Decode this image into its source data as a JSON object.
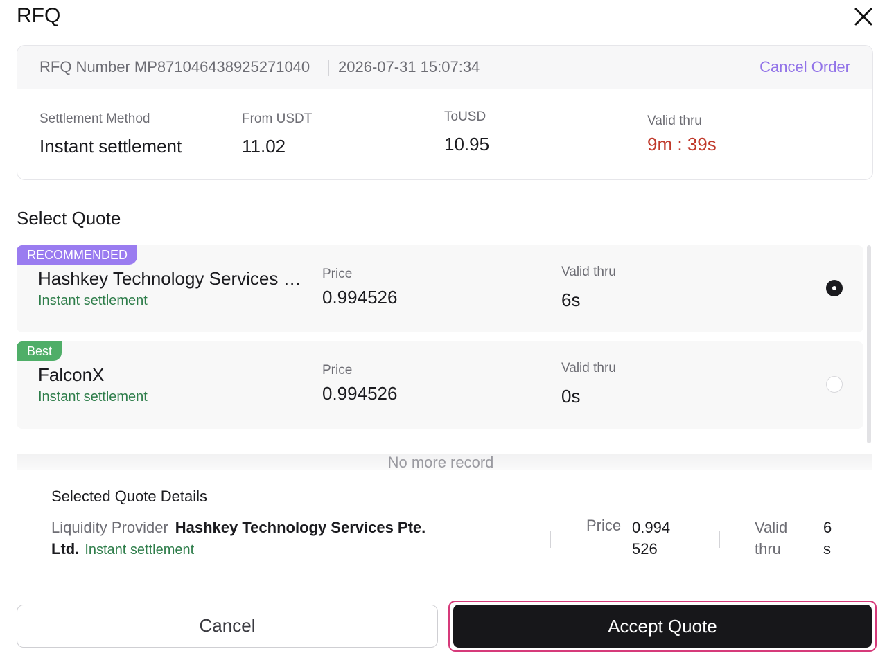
{
  "dialog": {
    "title": "RFQ"
  },
  "summary": {
    "rfq_number": "RFQ Number MP871046438925271040",
    "timestamp": "2026-07-31 15:07:34",
    "cancel_order_label": "Cancel Order",
    "fields": {
      "settlement_label": "Settlement Method",
      "settlement_value": "Instant settlement",
      "from_label": "From USDT",
      "from_value": "11.02",
      "to_label": "ToUSD",
      "to_value": "10.95",
      "valid_label": "Valid thru",
      "valid_value": "9m : 39s"
    }
  },
  "quotes": {
    "title": "Select Quote",
    "items": [
      {
        "badge": "RECOMMENDED",
        "name": "Hashkey Technology Services Pte. Ltd.",
        "settlement": "Instant settlement",
        "price_label": "Price",
        "price": "0.994526",
        "valid_label": "Valid thru",
        "valid": "6s",
        "selected": true
      },
      {
        "badge": "Best",
        "name": "FalconX",
        "settlement": "Instant settlement",
        "price_label": "Price",
        "price": "0.994526",
        "valid_label": "Valid thru",
        "valid": "0s",
        "selected": false
      }
    ],
    "no_more": "No more record"
  },
  "details": {
    "title": "Selected Quote Details",
    "lp_label": "Liquidity Provider",
    "lp_value": "Hashkey Technology Services Pte. Ltd.",
    "lp_settlement": "Instant settlement",
    "price_label": "Price",
    "price_value": "0.994526",
    "valid_label": "Valid thru",
    "valid_value": "6s"
  },
  "actions": {
    "cancel": "Cancel",
    "accept": "Accept Quote"
  },
  "colors": {
    "accent": "#9273e8",
    "badge_recommended": "#9a7cf0",
    "badge_best": "#4fae68",
    "timer": "#c0392b",
    "settlement_green": "#2e7d4a"
  }
}
